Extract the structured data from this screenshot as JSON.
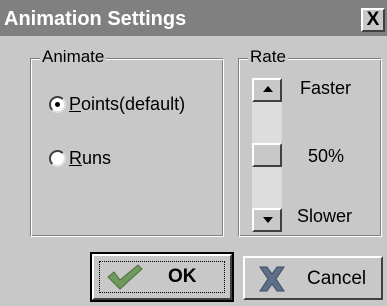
{
  "window": {
    "title": "Animation Settings",
    "close_glyph": "X"
  },
  "animate": {
    "legend": "Animate",
    "options": [
      {
        "prefix": "",
        "hotkey": "P",
        "rest": "oints(default)",
        "selected": true
      },
      {
        "prefix": "",
        "hotkey": "R",
        "rest": "uns",
        "selected": false
      }
    ]
  },
  "rate": {
    "legend": "Rate",
    "faster_label": "Faster",
    "value_label": "50%",
    "slower_label": "Slower",
    "level": 0.5
  },
  "buttons": {
    "ok_label": "OK",
    "cancel_label": "Cancel"
  },
  "icons": {
    "close": "close-icon",
    "scroll_up": "arrow-up-icon",
    "scroll_down": "arrow-down-icon",
    "ok": "checkmark-icon",
    "cancel": "x-cross-icon"
  },
  "colors": {
    "titlebar": "#808080",
    "title_text": "#ffffff",
    "face": "#c8c8c8",
    "ok_check": "#6f9a5c",
    "cancel_x": "#5c7088"
  }
}
